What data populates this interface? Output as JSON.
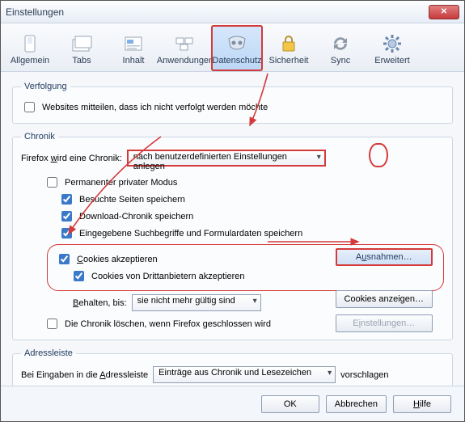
{
  "window": {
    "title": "Einstellungen"
  },
  "toolbar": {
    "general": "Allgemein",
    "tabs": "Tabs",
    "content": "Inhalt",
    "apps": "Anwendungen",
    "privacy": "Datenschutz",
    "security": "Sicherheit",
    "sync": "Sync",
    "advanced": "Erweitert"
  },
  "tracking": {
    "legend": "Verfolgung",
    "dnt": "Websites mitteilen, dass ich nicht verfolgt werden möchte"
  },
  "history": {
    "legend": "Chronik",
    "mode_label_pre": "Firefox ",
    "mode_label_u": "w",
    "mode_label_post": "ird eine Chronik:",
    "mode_value": "nach benutzerdefinierten Einstellungen anlegen",
    "permanent_pb": "Permanenter privater Modus",
    "remember_pages": "Besuchte Seiten speichern",
    "remember_downloads": "Download-Chronik speichern",
    "remember_form": "Eingegebene Suchbegriffe und Formulardaten speichern",
    "accept_cookies_pre": "",
    "accept_cookies_u": "C",
    "accept_cookies_post": "ookies akzeptieren",
    "third_party": "Cookies von Drittanbietern akzeptieren",
    "keep_label_pre": "",
    "keep_label_u": "B",
    "keep_label_post": "ehalten, bis:",
    "keep_value": "sie nicht mehr gültig sind",
    "clear_on_close": "Die Chronik löschen, wenn Firefox geschlossen wird",
    "exceptions_btn_pre": "A",
    "exceptions_btn_u": "u",
    "exceptions_btn_post": "snahmen…",
    "show_cookies_btn": "Cookies anzeigen…",
    "settings_btn_pre": "E",
    "settings_btn_u": "i",
    "settings_btn_post": "nstellungen…"
  },
  "locationbar": {
    "legend": "Adressleiste",
    "label_pre": "Bei Eingaben in die ",
    "label_u": "A",
    "label_post": "dressleiste",
    "value": "Einträge aus Chronik und Lesezeichen",
    "suffix": "vorschlagen"
  },
  "footer": {
    "ok": "OK",
    "cancel": "Abbrechen",
    "help_u": "H",
    "help_post": "ilfe"
  }
}
